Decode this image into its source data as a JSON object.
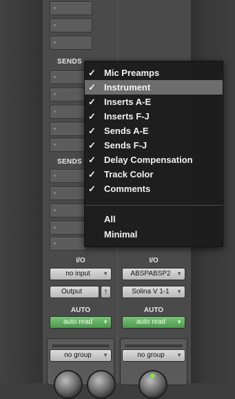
{
  "sections": {
    "sends_label": "SENDS",
    "sends_label_2": "SENDS"
  },
  "strip1": {
    "io_label": "I/O",
    "input": "no input",
    "output": "Output",
    "auto_label": "AUTO",
    "auto_mode": "auto read",
    "group": "no group"
  },
  "strip2": {
    "io_label": "I/O",
    "input": "ABSPABSP2",
    "output": "Solina V 1-1",
    "auto_label": "AUTO",
    "auto_mode": "auto read",
    "group": "no group"
  },
  "menu": {
    "items": [
      {
        "label": "Mic Preamps",
        "checked": "✓"
      },
      {
        "label": "Instrument",
        "checked": "✓"
      },
      {
        "label": "Inserts A-E",
        "checked": "✓"
      },
      {
        "label": "Inserts F-J",
        "checked": "✓"
      },
      {
        "label": "Sends A-E",
        "checked": "✓"
      },
      {
        "label": "Sends F-J",
        "checked": "✓"
      },
      {
        "label": "Delay Compensation",
        "checked": "✓"
      },
      {
        "label": "Track Color",
        "checked": "✓"
      },
      {
        "label": "Comments",
        "checked": "✓"
      }
    ],
    "all": "All",
    "minimal": "Minimal",
    "highlight_color": "#6d6d6d"
  },
  "icons": {
    "check": "checkmark-icon",
    "dropdown": "triangle-down-icon",
    "link": "link-icon"
  }
}
